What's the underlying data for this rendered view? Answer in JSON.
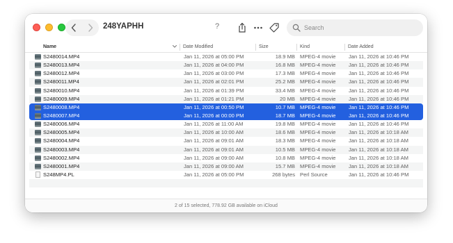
{
  "window": {
    "title": "248YAPHH",
    "help_label": "?",
    "search": {
      "placeholder": "Search",
      "value": ""
    }
  },
  "icons": {
    "back": "chevron-left-icon",
    "forward": "chevron-right-icon",
    "share": "share-icon",
    "more": "ellipsis-icon",
    "tag": "tag-icon",
    "search": "magnifier-icon"
  },
  "columns": {
    "name": "Name",
    "date_modified": "Date Modified",
    "size": "Size",
    "kind": "Kind",
    "date_added": "Date Added"
  },
  "files": [
    {
      "name": "S2480014.MP4",
      "modified": "Jan 11, 2026 at 05:00 PM",
      "size": "18.9 MB",
      "kind": "MPEG-4 movie",
      "added": "Jan 11, 2026 at 10:46 PM",
      "type": "movie",
      "selected": false
    },
    {
      "name": "S2480013.MP4",
      "modified": "Jan 11, 2026 at 04:00 PM",
      "size": "16.8 MB",
      "kind": "MPEG-4 movie",
      "added": "Jan 11, 2026 at 10:46 PM",
      "type": "movie",
      "selected": false
    },
    {
      "name": "S2480012.MP4",
      "modified": "Jan 11, 2026 at 03:00 PM",
      "size": "17.3 MB",
      "kind": "MPEG-4 movie",
      "added": "Jan 11, 2026 at 10:46 PM",
      "type": "movie",
      "selected": false
    },
    {
      "name": "S2480011.MP4",
      "modified": "Jan 11, 2026 at 02:01 PM",
      "size": "25.2 MB",
      "kind": "MPEG-4 movie",
      "added": "Jan 11, 2026 at 10:46 PM",
      "type": "movie",
      "selected": false
    },
    {
      "name": "S2480010.MP4",
      "modified": "Jan 11, 2026 at 01:39 PM",
      "size": "33.4 MB",
      "kind": "MPEG-4 movie",
      "added": "Jan 11, 2026 at 10:46 PM",
      "type": "movie",
      "selected": false
    },
    {
      "name": "S2480009.MP4",
      "modified": "Jan 11, 2026 at 01:21 PM",
      "size": "20 MB",
      "kind": "MPEG-4 movie",
      "added": "Jan 11, 2026 at 10:46 PM",
      "type": "movie",
      "selected": false
    },
    {
      "name": "S2480008.MP4",
      "modified": "Jan 11, 2026 at 00:50 PM",
      "size": "10.7 MB",
      "kind": "MPEG-4 movie",
      "added": "Jan 11, 2026 at 10:46 PM",
      "type": "movie",
      "selected": true
    },
    {
      "name": "S2480007.MP4",
      "modified": "Jan 11, 2026 at 00:00 PM",
      "size": "18.7 MB",
      "kind": "MPEG-4 movie",
      "added": "Jan 11, 2026 at 10:46 PM",
      "type": "movie",
      "selected": true
    },
    {
      "name": "S2480006.MP4",
      "modified": "Jan 11, 2026 at 11:00 AM",
      "size": "19.8 MB",
      "kind": "MPEG-4 movie",
      "added": "Jan 11, 2026 at 10:46 PM",
      "type": "movie",
      "selected": false
    },
    {
      "name": "S2480005.MP4",
      "modified": "Jan 11, 2026 at 10:00 AM",
      "size": "18.6 MB",
      "kind": "MPEG-4 movie",
      "added": "Jan 11, 2026 at 10:18 AM",
      "type": "movie",
      "selected": false
    },
    {
      "name": "S2480004.MP4",
      "modified": "Jan 11, 2026 at 09:01 AM",
      "size": "18.3 MB",
      "kind": "MPEG-4 movie",
      "added": "Jan 11, 2026 at 10:18 AM",
      "type": "movie",
      "selected": false
    },
    {
      "name": "S2480003.MP4",
      "modified": "Jan 11, 2026 at 09:01 AM",
      "size": "10.5 MB",
      "kind": "MPEG-4 movie",
      "added": "Jan 11, 2026 at 10:18 AM",
      "type": "movie",
      "selected": false
    },
    {
      "name": "S2480002.MP4",
      "modified": "Jan 11, 2026 at 09:00 AM",
      "size": "10.8 MB",
      "kind": "MPEG-4 movie",
      "added": "Jan 11, 2026 at 10:18 AM",
      "type": "movie",
      "selected": false
    },
    {
      "name": "S2480001.MP4",
      "modified": "Jan 11, 2026 at 09:00 AM",
      "size": "15.7 MB",
      "kind": "MPEG-4 movie",
      "added": "Jan 11, 2026 at 10:18 AM",
      "type": "movie",
      "selected": false
    },
    {
      "name": "S248MP4.PL",
      "modified": "Jan 11, 2026 at 05:00 PM",
      "size": "268 bytes",
      "kind": "Perl Source",
      "added": "Jan 11, 2026 at 10:46 PM",
      "type": "doc",
      "selected": false
    }
  ],
  "status_bar": "2 of 15 selected, 778.92 GB available on iCloud"
}
